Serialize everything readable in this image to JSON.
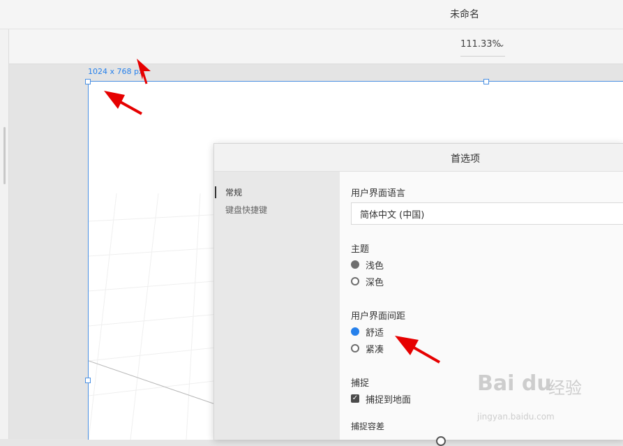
{
  "window": {
    "title": "未命名"
  },
  "toolbar": {
    "zoom": "111.33%"
  },
  "artboard": {
    "size_label": "1024 x 768 px"
  },
  "preferences": {
    "title": "首选项",
    "nav": [
      "常规",
      "键盘快捷键"
    ],
    "ui_language": {
      "label": "用户界面语言",
      "value": "简体中文 (中国)"
    },
    "theme": {
      "label": "主题",
      "options": [
        "浅色",
        "深色"
      ],
      "selected": "浅色"
    },
    "ui_spacing": {
      "label": "用户界面间距",
      "options": [
        "舒适",
        "紧凑"
      ],
      "selected": "舒适"
    },
    "snap": {
      "label": "捕捉",
      "checkbox_label": "捕捉到地面",
      "checked": true
    },
    "snap_tolerance": {
      "label": "捕捉容差"
    }
  },
  "watermark": {
    "brand": "Bai du",
    "cn": "经验",
    "sub": "jingyan.baidu.com"
  },
  "colors": {
    "accent": "#2680eb",
    "annotation_arrow": "#e60000"
  }
}
